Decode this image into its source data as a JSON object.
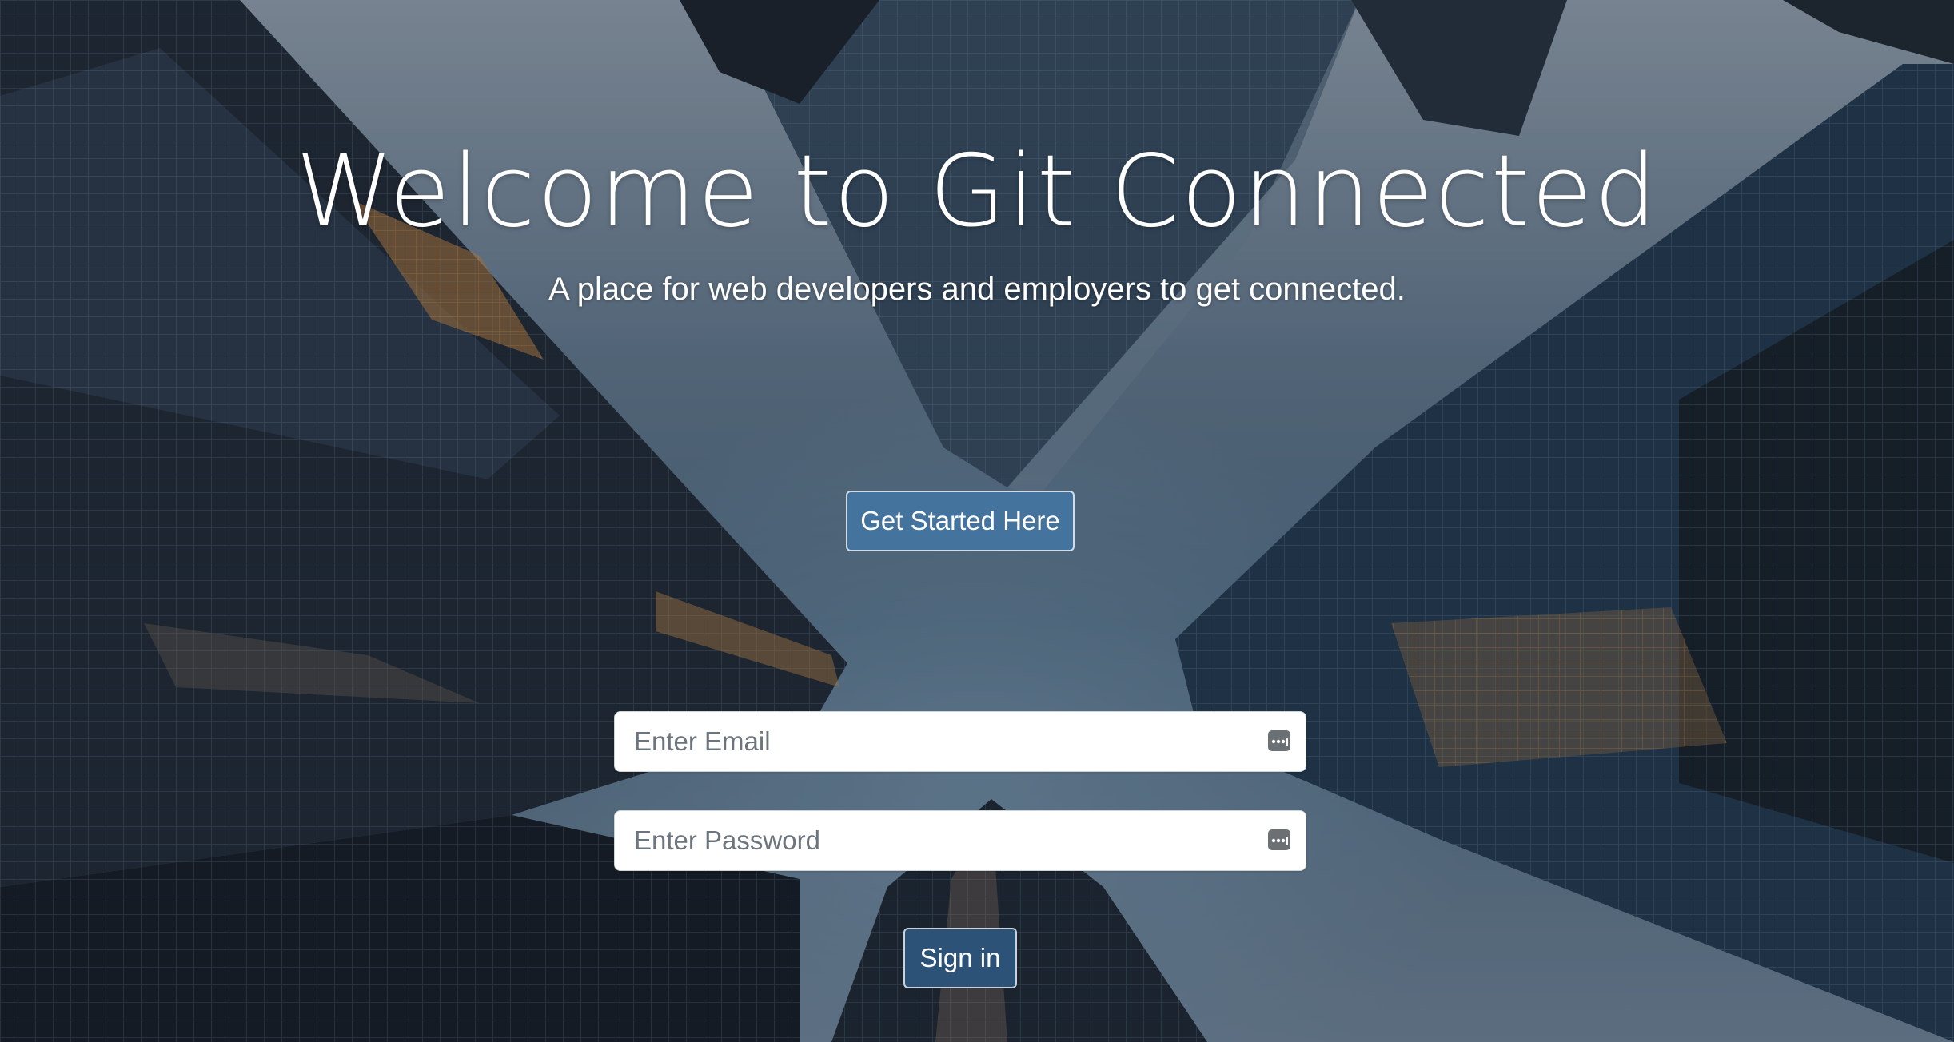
{
  "hero": {
    "title": "Welcome to Git Connected",
    "subtitle": "A place for web developers and employers to get connected."
  },
  "cta": {
    "get_started_label": "Get Started Here"
  },
  "login_form": {
    "email_placeholder": "Enter Email",
    "email_value": "",
    "password_placeholder": "Enter Password",
    "password_value": "",
    "password_manager_icon": "password-manager-icon",
    "sign_in_label": "Sign in"
  },
  "colors": {
    "primary_button": "#44739e",
    "signin_button": "#2c5277",
    "text": "#ffffff",
    "placeholder": "#6c757d"
  }
}
